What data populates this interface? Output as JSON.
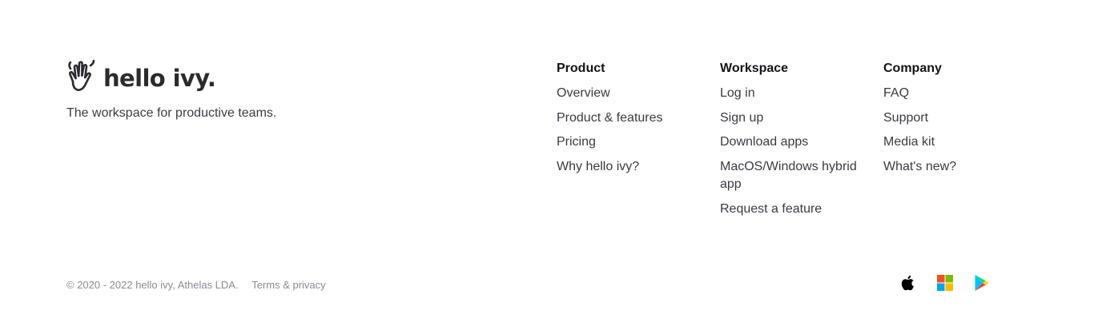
{
  "brand": {
    "name": "hello ivy.",
    "tagline": "The workspace for productive teams.",
    "logo_icon": "waving-hand-icon"
  },
  "columns": {
    "product": {
      "title": "Product",
      "links": [
        "Overview",
        "Product & features",
        "Pricing",
        "Why hello ivy?"
      ]
    },
    "workspace": {
      "title": "Workspace",
      "links": [
        "Log in",
        "Sign up",
        "Download apps",
        "MacOS/Windows hybrid app",
        "Request a feature"
      ]
    },
    "company": {
      "title": "Company",
      "links": [
        "FAQ",
        "Support",
        "Media kit",
        "What's new?"
      ]
    }
  },
  "footer": {
    "copyright": "© 2020 - 2022 hello ivy, Athelas LDA.",
    "terms": "Terms & privacy"
  },
  "stores": [
    {
      "icon": "apple-icon"
    },
    {
      "icon": "windows-icon"
    },
    {
      "icon": "google-play-icon"
    }
  ],
  "colors": {
    "text": "#2b2b33",
    "muted": "#8a8a93",
    "windows_red": "#f25022",
    "windows_green": "#7fba00",
    "windows_blue": "#00a4ef",
    "windows_yellow": "#ffb900"
  }
}
